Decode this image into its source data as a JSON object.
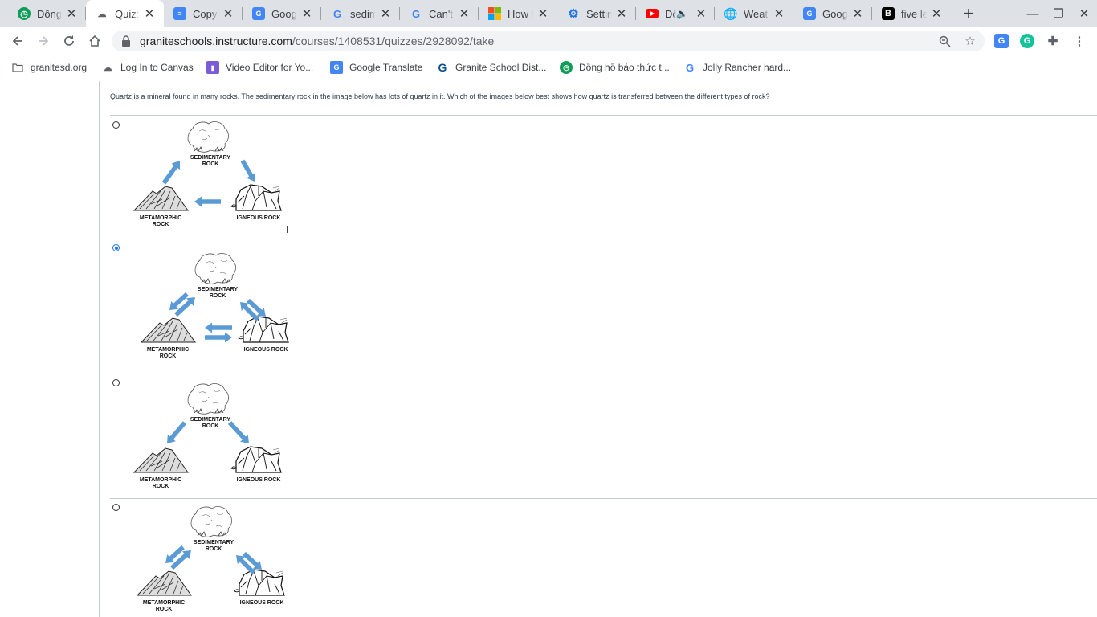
{
  "tabs": [
    {
      "title": "Đồng hồ",
      "icon": "clock-green-icon",
      "color": "#0f9d58"
    },
    {
      "title": "Quiz: Transfer",
      "icon": "canvas-icon",
      "color": "#5f6368"
    },
    {
      "title": "Copy of",
      "icon": "docs-icon",
      "color": "#4285f4"
    },
    {
      "title": "Google",
      "icon": "google-translate-icon",
      "color": "#4285f4"
    },
    {
      "title": "sedimentary",
      "icon": "google-g-icon",
      "color": "#4285f4"
    },
    {
      "title": "Can't f",
      "icon": "google-g-icon",
      "color": "#4285f4"
    },
    {
      "title": "How to",
      "icon": "microsoft-icon",
      "color": "#f25022"
    },
    {
      "title": "Settings",
      "icon": "gear-icon",
      "color": "#1a73e8"
    },
    {
      "title": "Đồng",
      "icon": "youtube-icon",
      "color": "#ff0000"
    },
    {
      "title": "Weather",
      "icon": "globe-icon",
      "color": "#5f6368"
    },
    {
      "title": "Google",
      "icon": "google-translate-icon",
      "color": "#4285f4"
    },
    {
      "title": "five letter",
      "icon": "b-logo-icon",
      "color": "#000000"
    }
  ],
  "url": {
    "domain": "graniteschools.instructure.com",
    "path": "/courses/1408531/quizzes/2928092/take"
  },
  "bookmarks": [
    {
      "label": "granitesd.org",
      "icon": "folder-icon"
    },
    {
      "label": "Log In to Canvas",
      "icon": "canvas-icon"
    },
    {
      "label": "Video Editor for Yo...",
      "icon": "video-editor-icon"
    },
    {
      "label": "Google Translate",
      "icon": "google-translate-icon"
    },
    {
      "label": "Granite School Dist...",
      "icon": "granite-g-icon"
    },
    {
      "label": "Đồng hồ báo thức t...",
      "icon": "clock-green-icon"
    },
    {
      "label": "Jolly Rancher hard...",
      "icon": "google-g-icon"
    }
  ],
  "question": {
    "text": "Quartz is a mineral found in many rocks. The sedimentary rock in the image below has lots of quartz in it. Which of the images below best shows how quartz is transferred between the different types of rock?"
  },
  "rock_labels": {
    "sedimentary_1": "SEDIMENTARY",
    "sedimentary_2": "ROCK",
    "metamorphic_1": "METAMORPHIC",
    "metamorphic_2": "ROCK",
    "igneous": "IGNEOUS ROCK"
  },
  "answers": [
    {
      "option": 1,
      "selected": false,
      "arrows": "one-way cycle: sedimentary to igneous to metamorphic to sedimentary"
    },
    {
      "option": 2,
      "selected": true,
      "arrows": "two-way between all three rock types"
    },
    {
      "option": 3,
      "selected": false,
      "arrows": "one-way from sedimentary to metamorphic and to igneous"
    },
    {
      "option": 4,
      "selected": false,
      "arrows": "two-way between sedimentary and each other rock"
    }
  ],
  "colors": {
    "arrow": "#5b9bd5",
    "radio_selected": "#1a73e8",
    "tabstrip": "#dee1e6"
  }
}
